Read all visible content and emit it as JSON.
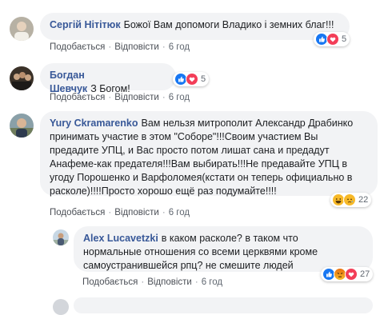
{
  "comments": [
    {
      "author": "Сергій Нітітюк",
      "text": "Божої Вам допомоги Владико і земних благ!!!",
      "actions": {
        "like": "Подобається",
        "reply": "Відповісти",
        "time": "6 год"
      },
      "reaction_count": "5",
      "reaction_icons": [
        "like-icon",
        "love-icon"
      ]
    },
    {
      "author": "Богдан Шевчук",
      "text": "З Богом!",
      "actions": {
        "like": "Подобається",
        "reply": "Відповісти",
        "time": "6 год"
      },
      "reaction_count": "5",
      "reaction_icons": [
        "like-icon",
        "love-icon"
      ]
    },
    {
      "author": "Yury Ckramarenko",
      "text": "Вам нельзя митрополит Александр Драбинко\nпринимать участие в этом \"Соборе\"!!!Своим участием Вы\nпредадите УПЦ, и Вас просто потом лишат сана и предадут\nАнафеме-как предателя!!!Вам выбирать!!!Не предавайте УПЦ в\nугоду Порошенко и Варфоломея(кстати он теперь официально в\nрасколе)!!!!Просто хорошо ещё раз подумайте!!!!",
      "actions": {
        "like": "Подобається",
        "reply": "Відповісти",
        "time": "6 год"
      },
      "reaction_count": "22",
      "reaction_icons": [
        "haha-icon",
        "sad-icon"
      ]
    },
    {
      "author": "Alex Lucavetzki",
      "text": "в каком расколе? в таком что\nнормальные отношения со всеми церквями кроме\nсамоустранившейся рпц? не смешите людей",
      "actions": {
        "like": "Подобається",
        "reply": "Відповісти",
        "time": "6 год"
      },
      "reaction_count": "27",
      "reaction_icons": [
        "like-icon",
        "angry-icon",
        "love-icon"
      ]
    }
  ],
  "colors": {
    "author": "#385898",
    "bubble": "#f2f3f5",
    "like": "#1877f2",
    "love": "#f33e58",
    "yellow": "#f7b928"
  }
}
